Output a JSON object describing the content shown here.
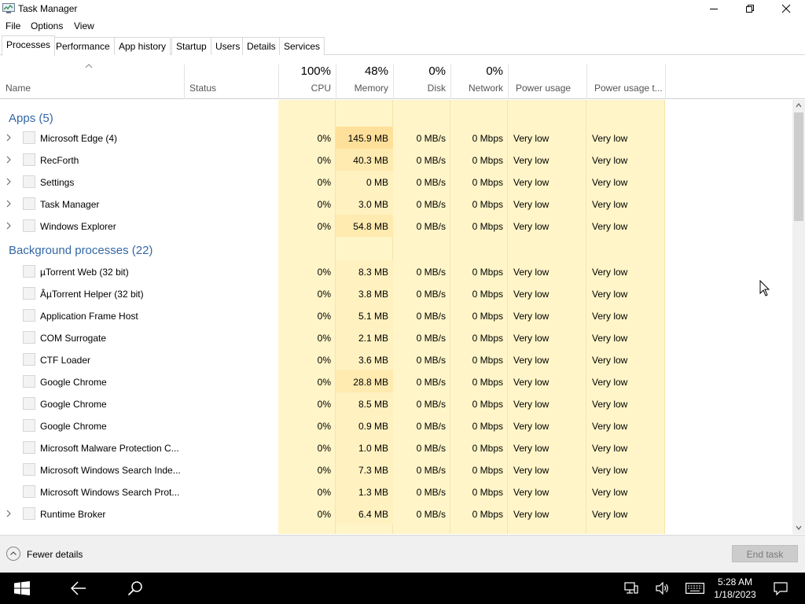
{
  "window": {
    "title": "Task Manager"
  },
  "menu": [
    "File",
    "Options",
    "View"
  ],
  "tabs": [
    "Processes",
    "Performance",
    "App history",
    "Startup",
    "Users",
    "Details",
    "Services"
  ],
  "active_tab": "Processes",
  "columns": {
    "name": "Name",
    "status": "Status",
    "cpu": {
      "pct": "100%",
      "label": "CPU"
    },
    "memory": {
      "pct": "48%",
      "label": "Memory"
    },
    "disk": {
      "pct": "0%",
      "label": "Disk"
    },
    "network": {
      "pct": "0%",
      "label": "Network"
    },
    "power": "Power usage",
    "power_trend": "Power usage t..."
  },
  "groups": {
    "apps": "Apps (5)",
    "background": "Background processes (22)"
  },
  "apps": [
    {
      "name": "Microsoft Edge (4)",
      "cpu": "0%",
      "memory": "145.9 MB",
      "disk": "0 MB/s",
      "network": "0 Mbps",
      "power": "Very low",
      "trend": "Very low",
      "expandable": true
    },
    {
      "name": "RecForth",
      "cpu": "0%",
      "memory": "40.3 MB",
      "disk": "0 MB/s",
      "network": "0 Mbps",
      "power": "Very low",
      "trend": "Very low",
      "expandable": true
    },
    {
      "name": "Settings",
      "cpu": "0%",
      "memory": "0 MB",
      "disk": "0 MB/s",
      "network": "0 Mbps",
      "power": "Very low",
      "trend": "Very low",
      "expandable": true
    },
    {
      "name": "Task Manager",
      "cpu": "0%",
      "memory": "3.0 MB",
      "disk": "0 MB/s",
      "network": "0 Mbps",
      "power": "Very low",
      "trend": "Very low",
      "expandable": true
    },
    {
      "name": "Windows Explorer",
      "cpu": "0%",
      "memory": "54.8 MB",
      "disk": "0 MB/s",
      "network": "0 Mbps",
      "power": "Very low",
      "trend": "Very low",
      "expandable": true
    }
  ],
  "background": [
    {
      "name": "µTorrent Web (32 bit)",
      "cpu": "0%",
      "memory": "8.3 MB",
      "disk": "0 MB/s",
      "network": "0 Mbps",
      "power": "Very low",
      "trend": "Very low",
      "expandable": false
    },
    {
      "name": "ÂµTorrent Helper (32 bit)",
      "cpu": "0%",
      "memory": "3.8 MB",
      "disk": "0 MB/s",
      "network": "0 Mbps",
      "power": "Very low",
      "trend": "Very low",
      "expandable": false
    },
    {
      "name": "Application Frame Host",
      "cpu": "0%",
      "memory": "5.1 MB",
      "disk": "0 MB/s",
      "network": "0 Mbps",
      "power": "Very low",
      "trend": "Very low",
      "expandable": false
    },
    {
      "name": "COM Surrogate",
      "cpu": "0%",
      "memory": "2.1 MB",
      "disk": "0 MB/s",
      "network": "0 Mbps",
      "power": "Very low",
      "trend": "Very low",
      "expandable": false
    },
    {
      "name": "CTF Loader",
      "cpu": "0%",
      "memory": "3.6 MB",
      "disk": "0 MB/s",
      "network": "0 Mbps",
      "power": "Very low",
      "trend": "Very low",
      "expandable": false
    },
    {
      "name": "Google Chrome",
      "cpu": "0%",
      "memory": "28.8 MB",
      "disk": "0 MB/s",
      "network": "0 Mbps",
      "power": "Very low",
      "trend": "Very low",
      "expandable": false
    },
    {
      "name": "Google Chrome",
      "cpu": "0%",
      "memory": "8.5 MB",
      "disk": "0 MB/s",
      "network": "0 Mbps",
      "power": "Very low",
      "trend": "Very low",
      "expandable": false
    },
    {
      "name": "Google Chrome",
      "cpu": "0%",
      "memory": "0.9 MB",
      "disk": "0 MB/s",
      "network": "0 Mbps",
      "power": "Very low",
      "trend": "Very low",
      "expandable": false
    },
    {
      "name": "Microsoft Malware Protection C...",
      "cpu": "0%",
      "memory": "1.0 MB",
      "disk": "0 MB/s",
      "network": "0 Mbps",
      "power": "Very low",
      "trend": "Very low",
      "expandable": false
    },
    {
      "name": "Microsoft Windows Search Inde...",
      "cpu": "0%",
      "memory": "7.3 MB",
      "disk": "0 MB/s",
      "network": "0 Mbps",
      "power": "Very low",
      "trend": "Very low",
      "expandable": false
    },
    {
      "name": "Microsoft Windows Search Prot...",
      "cpu": "0%",
      "memory": "1.3 MB",
      "disk": "0 MB/s",
      "network": "0 Mbps",
      "power": "Very low",
      "trend": "Very low",
      "expandable": false
    },
    {
      "name": "Runtime Broker",
      "cpu": "0%",
      "memory": "6.4 MB",
      "disk": "0 MB/s",
      "network": "0 Mbps",
      "power": "Very low",
      "trend": "Very low",
      "expandable": true
    }
  ],
  "footer": {
    "fewer_details": "Fewer details",
    "end_task": "End task"
  },
  "taskbar": {
    "time": "5:28 AM",
    "date": "1/18/2023",
    "icons": [
      "windows-start-icon",
      "back-icon",
      "search-icon",
      "network-icon",
      "volume-icon",
      "keyboard-icon",
      "notification-icon"
    ]
  },
  "colors": {
    "heat_light": "#fff9e1",
    "heat_mid": "#fff4c4",
    "heat_strong": "#ffe8a6",
    "group_text": "#3367a6"
  }
}
